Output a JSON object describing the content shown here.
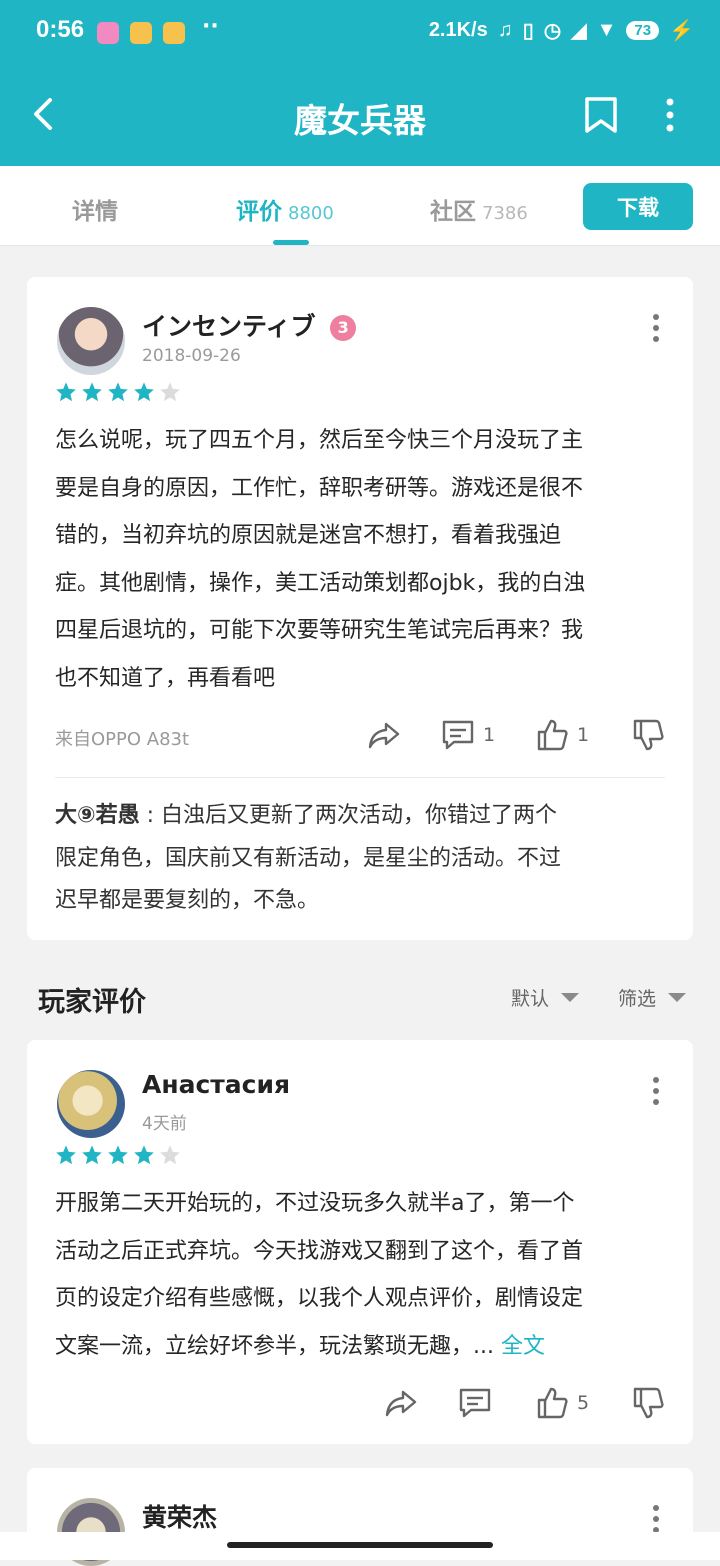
{
  "status_bar": {
    "time": "0:56",
    "network_speed": "2.1K/s",
    "battery": "73",
    "lte": "LTE"
  },
  "header": {
    "title": "魔女兵器",
    "back_icon": "chevron-left-icon",
    "bookmark_icon": "bookmark-icon",
    "more_icon": "more-vertical-icon"
  },
  "tabs": [
    {
      "label": "详情",
      "count": ""
    },
    {
      "label": "评价",
      "count": "8800"
    },
    {
      "label": "社区",
      "count": "7386"
    }
  ],
  "download_label": "下载",
  "featured_review": {
    "author": "インセンティブ",
    "badge": "3",
    "date": "2018-09-26",
    "rating": 4,
    "max_rating": 5,
    "lines": [
      "怎么说呢，玩了四五个月，然后至今快三个月没玩了主",
      "要是自身的原因，工作忙，辞职考研等。游戏还是很不",
      "错的，当初弃坑的原因就是迷宫不想打，看着我强迫",
      "症。其他剧情，操作，美工活动策划都ojbk，我的白浊",
      "四星后退坑的，可能下次要等研究生笔试完后再来？我",
      "也不知道了，再看看吧"
    ],
    "device": "来自OPPO A83t",
    "comment_count": "1",
    "like_count": "1",
    "reply": {
      "author": "大⑨若愚",
      "lines": [
        "白浊后又更新了两次活动，你错过了两个",
        "限定角色，国庆前又有新活动，是星尘的活动。不过",
        "迟早都是要复刻的，不急。"
      ]
    }
  },
  "player_reviews": {
    "title": "玩家评价",
    "sort_label": "默认",
    "filter_label": "筛选",
    "items": [
      {
        "author": "Анастасия",
        "date": "4天前",
        "rating": 4,
        "lines": [
          "开服第二天开始玩的，不过没玩多久就半a了，第一个",
          "活动之后正式弃坑。今天找游戏又翻到了这个，看了首",
          "页的设定介绍有些感慨，以我个人观点评价，剧情设定",
          "文案一流，立绘好坏参半，玩法繁琐无趣，... "
        ],
        "more_label": "全文",
        "like_count": "5"
      },
      {
        "author": "黄荣杰"
      }
    ]
  },
  "colors": {
    "primary": "#20b5c4",
    "star_empty": "#dcdcdc",
    "badge": "#ef7fa0"
  }
}
